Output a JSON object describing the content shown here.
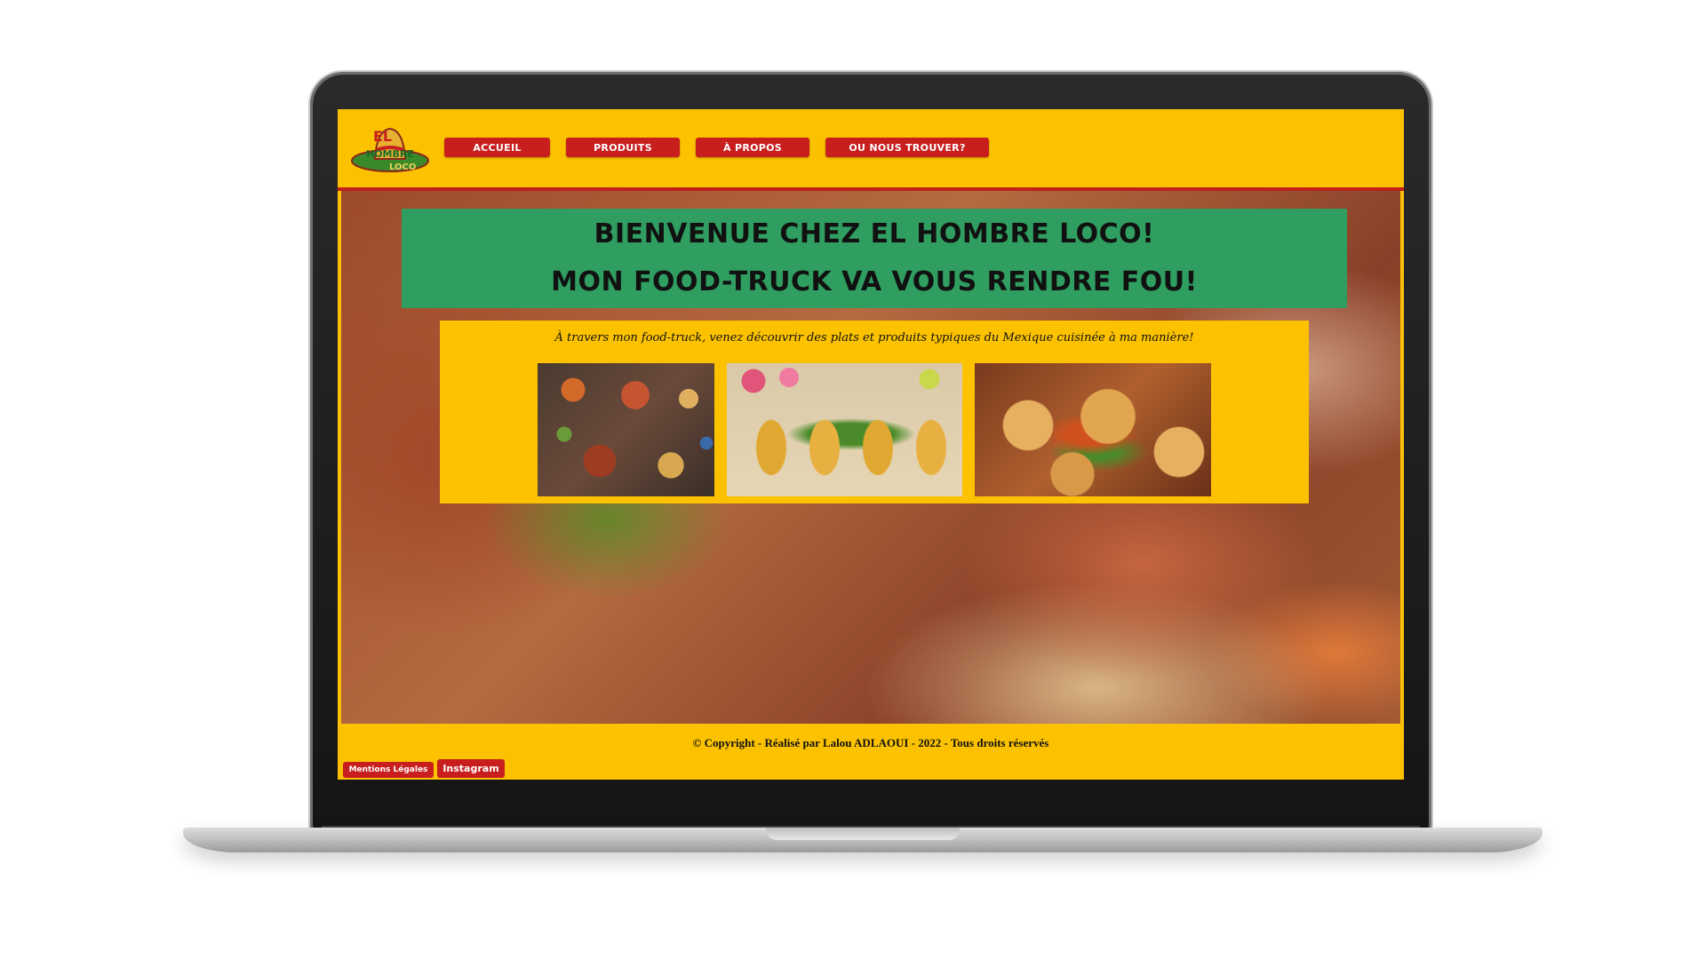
{
  "header": {
    "logo_text_top": "EL",
    "logo_text_mid": "HOMBRE",
    "logo_text_bottom": "LOCO",
    "nav": [
      {
        "label": "ACCUEIL"
      },
      {
        "label": "PRODUITS"
      },
      {
        "label": "À PROPOS"
      },
      {
        "label": "OU NOUS TROUVER?"
      }
    ]
  },
  "hero": {
    "welcome_line1": "BIENVENUE CHEZ EL HOMBRE LOCO!",
    "welcome_line2": "MON FOOD-TRUCK VA VOUS RENDRE FOU!"
  },
  "intro": {
    "text": "À travers mon food-truck, venez découvrir des plats et produits typiques du Mexique cuisinée à ma manière!"
  },
  "footer": {
    "copyright": "© Copyright - Réalisé par Lalou ADLAOUI - 2022 - Tous droits réservés",
    "mentions_label": "Mentions Légales",
    "instagram_label": "Instagram"
  },
  "colors": {
    "yellow": "#fcc200",
    "red": "#c81e1e",
    "green": "#2f9e60"
  }
}
